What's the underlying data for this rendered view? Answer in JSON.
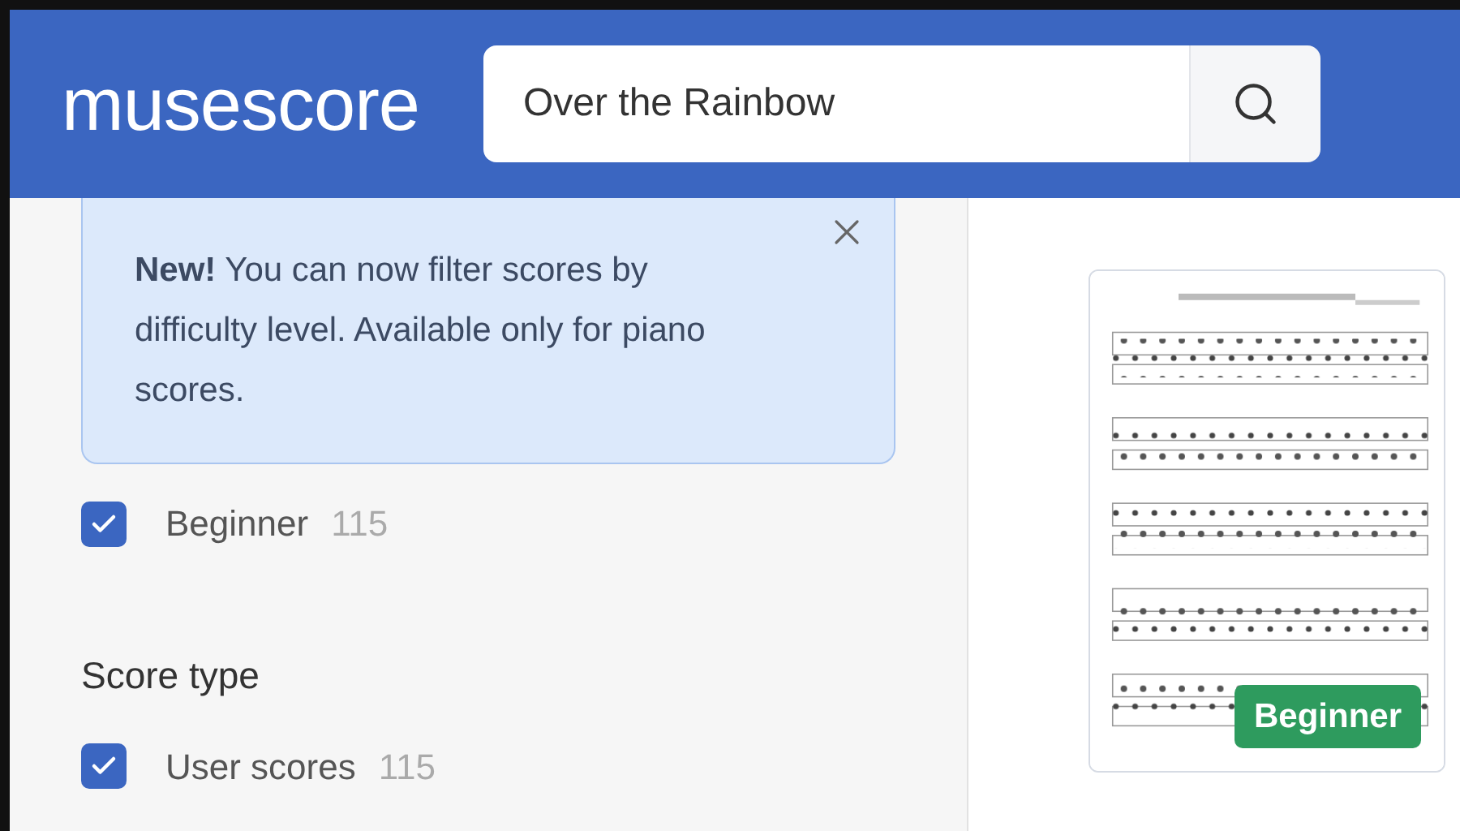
{
  "header": {
    "logo": "musescore",
    "search": {
      "value": "Over the Rainbow"
    }
  },
  "notice": {
    "text": "**New!** You can now filter scores by difficulty level. Available only for piano scores."
  },
  "difficulty_filters": [
    {
      "label": "Beginner",
      "count": "115",
      "checked": true
    }
  ],
  "score_type": {
    "title": "Score type",
    "filters": [
      {
        "label": "User scores",
        "count": "115",
        "checked": true
      }
    ]
  },
  "score_card": {
    "badge": "Beginner"
  }
}
